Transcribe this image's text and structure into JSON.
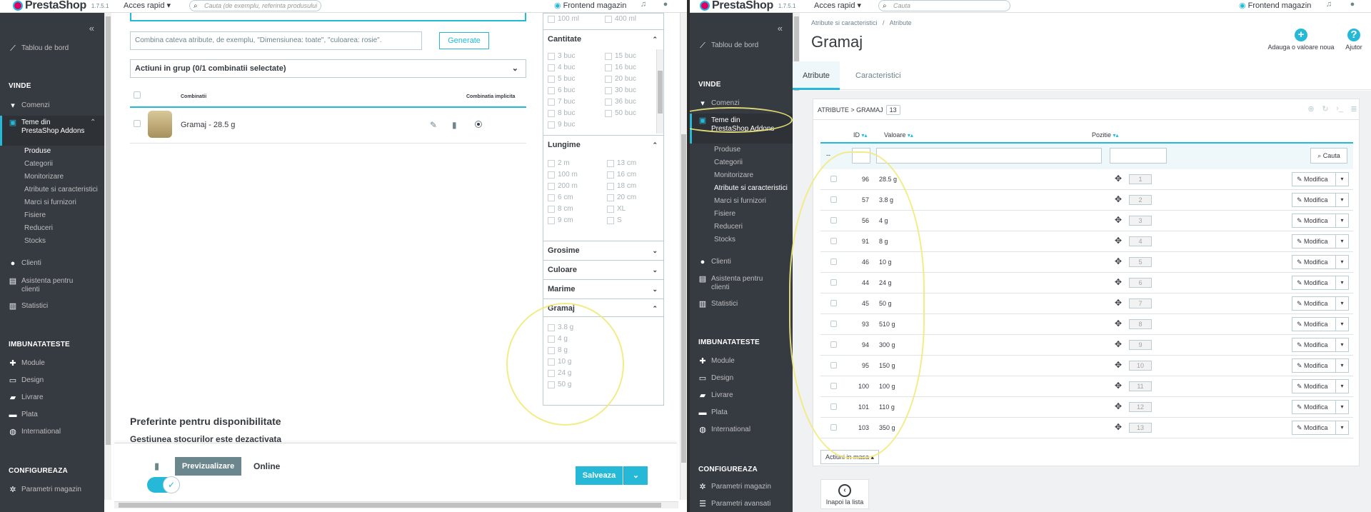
{
  "left": {
    "brand": {
      "name": "PrestaShop",
      "version": "1.7.5.1"
    },
    "topbar": {
      "quick_access": "Acces rapid ▾",
      "search_placeholder": "Cauta (de exemplu, referinta produsului",
      "frontend": "Frontend magazin"
    },
    "sidebar": {
      "dashboard": "Tablou de bord",
      "sell_head": "VINDE",
      "orders": "Comenzi",
      "themes": "Teme din PrestaShop Addons",
      "subs": [
        "Produse",
        "Categorii",
        "Monitorizare",
        "Atribute si caracteristici",
        "Marci si furnizori",
        "Fisiere",
        "Reduceri",
        "Stocks"
      ],
      "clients": "Clienti",
      "support": "Asistenta pentru clienti",
      "stats": "Statistici",
      "improve_head": "IMBUNATATESTE",
      "modules": "Module",
      "design": "Design",
      "shipping": "Livrare",
      "payment": "Plata",
      "international": "International",
      "config_head": "CONFIGUREAZA",
      "shop_params": "Parametri magazin"
    },
    "form": {
      "combine_placeholder": "Combina cateva atribute, de exemplu, \"Dimensiunea: toate\", \"culoarea: rosie\".",
      "generate": "Generate",
      "bulk_label": "Actiuni in grup (0/1 combinatii selectate)",
      "col_combinations": "Combinatii",
      "col_default": "Combinatia implicita",
      "combination": "Gramaj - 28.5 g",
      "availability_title": "Preferinte pentru disponibilitate",
      "stock_note": "Gestiunea stocurilor este dezactivata"
    },
    "filters": {
      "top_opts": [
        "100 ml",
        "400 ml"
      ],
      "cantitate": {
        "title": "Cantitate",
        "col1": [
          "3 buc",
          "4 buc",
          "5 buc",
          "6 buc",
          "7 buc",
          "8 buc",
          "9 buc"
        ],
        "col2": [
          "15 buc",
          "16 buc",
          "20 buc",
          "30 buc",
          "36 buc",
          "50 buc"
        ]
      },
      "lungime": {
        "title": "Lungime",
        "col1": [
          "2 m",
          "100 m",
          "200 m",
          "6 cm",
          "8 cm",
          "9 cm"
        ],
        "col2": [
          "13 cm",
          "16 cm",
          "18 cm",
          "20 cm",
          "XL",
          "S"
        ]
      },
      "grosime": "Grosime",
      "culoare": "Culoare",
      "marime": "Marime",
      "gramaj": {
        "title": "Gramaj",
        "opts": [
          "3.8 g",
          "4 g",
          "8 g",
          "10 g",
          "24 g",
          "50 g"
        ]
      }
    },
    "footer": {
      "preview": "Previzualizare",
      "online": "Online",
      "save": "Salveaza"
    }
  },
  "right": {
    "brand": {
      "name": "PrestaShop",
      "version": "1.7.5.1"
    },
    "topbar": {
      "quick_access": "Acces rapid ▾",
      "search_placeholder": "Cauta",
      "frontend": "Frontend magazin"
    },
    "sidebar": {
      "dashboard": "Tablou de bord",
      "sell_head": "VINDE",
      "orders": "Comenzi",
      "themes": "Teme din PrestaShop Addons",
      "subs": [
        "Produse",
        "Categorii",
        "Monitorizare",
        "Atribute si caracteristici",
        "Marci si furnizori",
        "Fisiere",
        "Reduceri",
        "Stocks"
      ],
      "clients": "Clienti",
      "support": "Asistenta pentru clienti",
      "stats": "Statistici",
      "improve_head": "IMBUNATATESTE",
      "modules": "Module",
      "design": "Design",
      "shipping": "Livrare",
      "payment": "Plata",
      "international": "International",
      "config_head": "CONFIGUREAZA",
      "shop_params": "Parametri magazin",
      "adv_params": "Parametri avansati"
    },
    "breadcrumb": {
      "parent": "Atribute si caracteristici",
      "sep": "/",
      "current": "Atribute"
    },
    "title": "Gramaj",
    "toolbar": {
      "add": "Adauga o valoare noua",
      "help": "Ajutor"
    },
    "tabs": [
      "Atribute",
      "Caracteristici"
    ],
    "panel": {
      "heading": "ATRIBUTE > GRAMAJ",
      "count": "13"
    },
    "columns": {
      "id": "ID",
      "value": "Valoare",
      "position": "Pozitie"
    },
    "filter_dash": "--",
    "search_btn": "Cauta",
    "edit_label": "Modifica",
    "rows": [
      {
        "id": "96",
        "value": "28.5 g",
        "pos": "1"
      },
      {
        "id": "57",
        "value": "3.8 g",
        "pos": "2"
      },
      {
        "id": "56",
        "value": "4 g",
        "pos": "3"
      },
      {
        "id": "91",
        "value": "8 g",
        "pos": "4"
      },
      {
        "id": "46",
        "value": "10 g",
        "pos": "5"
      },
      {
        "id": "44",
        "value": "24 g",
        "pos": "6"
      },
      {
        "id": "45",
        "value": "50 g",
        "pos": "7"
      },
      {
        "id": "93",
        "value": "510 g",
        "pos": "8"
      },
      {
        "id": "94",
        "value": "300 g",
        "pos": "9"
      },
      {
        "id": "95",
        "value": "150 g",
        "pos": "10"
      },
      {
        "id": "100",
        "value": "100 g",
        "pos": "11"
      },
      {
        "id": "101",
        "value": "110 g",
        "pos": "12"
      },
      {
        "id": "103",
        "value": "350 g",
        "pos": "13"
      }
    ],
    "bulk": "Actiuni in masa ▴",
    "back": "Inapoi la lista"
  },
  "colors": {
    "accent": "#25b9d7",
    "sidebar": "#363a41",
    "highlight": "#f1ea7a"
  }
}
